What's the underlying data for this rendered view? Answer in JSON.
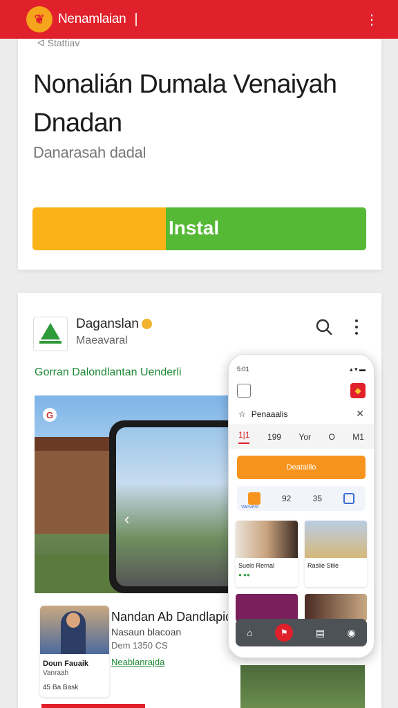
{
  "topbar": {
    "app_title": "Nenamlaian",
    "caret": "|",
    "logo_glyph": "❦",
    "menu_glyph": "⋮",
    "color": "#e0202a"
  },
  "card1": {
    "overline": "ᐊ Stattiav",
    "title": "Nonalián Dumala Venaiyah Dnadan",
    "subtitle": "Danarasah dadal",
    "install_label": "Instal",
    "install_progress_percent": 40,
    "colors": {
      "progress": "#fbb216",
      "remaining": "#55b935"
    }
  },
  "developer": {
    "name": "Daganslan",
    "subtitle": "Maeavaral",
    "section_link": "Gorran Dalondlantan Uenderli"
  },
  "hero": {
    "badge": "G",
    "nav_left": "‹",
    "nav_right": "›"
  },
  "news_card": {
    "title": "Doun Fauaik",
    "byline": "Vanraah",
    "footer": "45 Ba Bask"
  },
  "feature": {
    "title": "Nandan Ab Dandlapic",
    "subtitle": "Nasaun blacoan",
    "meta": "Dem 1350 CS",
    "link": "Neablanrajda"
  },
  "mini_phone": {
    "status_time": "5:01",
    "status_icons": "▴ ▾ ▬",
    "title": "Penaaalis",
    "close": "✕",
    "star": "☆",
    "tabs": [
      "1|1",
      "199",
      "Yor",
      "O",
      "M1"
    ],
    "cta": "Deatalilo",
    "chips": [
      "92",
      "35"
    ],
    "chip_label": "Vanvent",
    "tiles": [
      {
        "caption": "Suelo Rernal"
      },
      {
        "caption": "Raslie  Stile"
      }
    ],
    "bottom_icons": [
      "⌂",
      "⚑",
      "▤",
      "◉"
    ]
  }
}
